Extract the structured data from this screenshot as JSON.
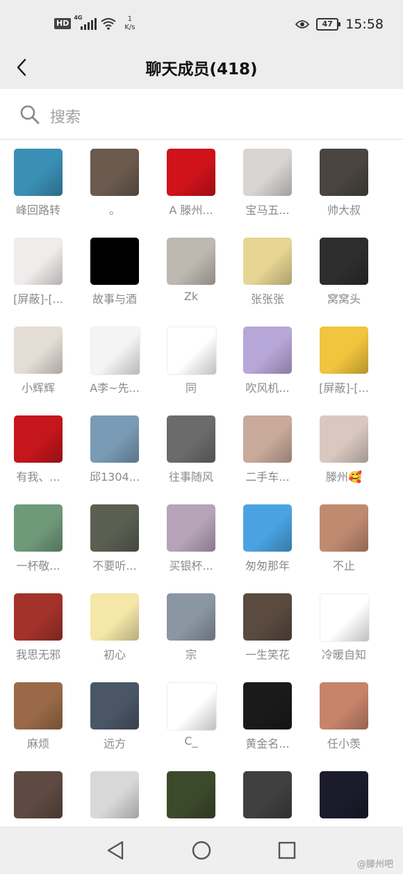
{
  "status_bar": {
    "hd": "HD",
    "net": "4G",
    "speed_value": "1",
    "speed_unit": "K/s",
    "battery": "47",
    "time": "15:58"
  },
  "header": {
    "title": "聊天成员(418)"
  },
  "search": {
    "placeholder": "搜索"
  },
  "members": [
    {
      "name": "峰回路转",
      "avatar_color": "#3a8fb5"
    },
    {
      "name": "。",
      "avatar_color": "#6b5a4e"
    },
    {
      "name": "A  滕州...",
      "avatar_color": "#d0121b"
    },
    {
      "name": "宝马五...",
      "avatar_color": "#d8d4d2"
    },
    {
      "name": "帅大叔",
      "avatar_color": "#4a4540"
    },
    {
      "name": "[屏蔽]-[...",
      "avatar_color": "#efeceb"
    },
    {
      "name": "故事与酒",
      "avatar_color": "#000000"
    },
    {
      "name": "Zk",
      "avatar_color": "#bdb8b0"
    },
    {
      "name": "张张张",
      "avatar_color": "#e6d592"
    },
    {
      "name": "窝窝头",
      "avatar_color": "#2e2e2e"
    },
    {
      "name": "小辉辉",
      "avatar_color": "#e4ddd6"
    },
    {
      "name": "A李~先...",
      "avatar_color": "#f4f4f4"
    },
    {
      "name": "同",
      "avatar_color": "#ffffff"
    },
    {
      "name": "吹风机...",
      "avatar_color": "#b7a6d8"
    },
    {
      "name": "[屏蔽]-[...",
      "avatar_color": "#f1c53d"
    },
    {
      "name": "有我、...",
      "avatar_color": "#c4161c"
    },
    {
      "name": "邱1304...",
      "avatar_color": "#7a9bb5"
    },
    {
      "name": "往事随风",
      "avatar_color": "#6b6b6b"
    },
    {
      "name": "二手车...",
      "avatar_color": "#c9a99a"
    },
    {
      "name": "滕州🥰",
      "avatar_color": "#d9c8c0"
    },
    {
      "name": "一杯敬...",
      "avatar_color": "#6f9a7a"
    },
    {
      "name": "不要听...",
      "avatar_color": "#5a5f52"
    },
    {
      "name": "买银杯...",
      "avatar_color": "#b6a3b8"
    },
    {
      "name": "匆匆那年",
      "avatar_color": "#4aa3e0"
    },
    {
      "name": "不止",
      "avatar_color": "#c08a70"
    },
    {
      "name": "我思无邪",
      "avatar_color": "#a3322b"
    },
    {
      "name": "初心",
      "avatar_color": "#f4e7a8"
    },
    {
      "name": "宗",
      "avatar_color": "#8b96a3"
    },
    {
      "name": "一生笑花",
      "avatar_color": "#5a4a40"
    },
    {
      "name": "冷暖自知",
      "avatar_color": "#ffffff"
    },
    {
      "name": "麻烦",
      "avatar_color": "#9a6a48"
    },
    {
      "name": "远方",
      "avatar_color": "#4a5666"
    },
    {
      "name": "C_",
      "avatar_color": "#ffffff"
    },
    {
      "name": "黄金名...",
      "avatar_color": "#1a1a1a"
    },
    {
      "name": "任小羡",
      "avatar_color": "#c7846a"
    },
    {
      "name": "",
      "avatar_color": "#5e4a42"
    },
    {
      "name": "",
      "avatar_color": "#d8d8d8"
    },
    {
      "name": "",
      "avatar_color": "#3c4a2c"
    },
    {
      "name": "",
      "avatar_color": "#404040"
    },
    {
      "name": "",
      "avatar_color": "#1b1b2b"
    }
  ],
  "watermark": "@滕州吧"
}
